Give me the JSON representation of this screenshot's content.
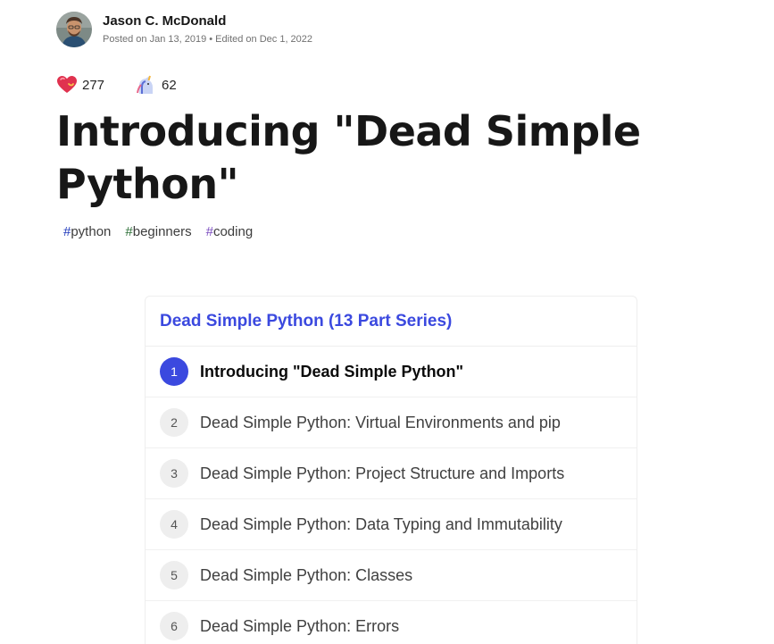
{
  "author": {
    "name": "Jason C. McDonald",
    "meta": "Posted on Jan 13, 2019 • Edited on Dec 1, 2022",
    "avatar_icon": "avatar-photo"
  },
  "reactions": [
    {
      "icon": "heart-icon",
      "count": "277"
    },
    {
      "icon": "unicorn-icon",
      "count": "62"
    }
  ],
  "article": {
    "title": "Introducing \"Dead Simple Python\""
  },
  "tags": [
    {
      "hash": "#",
      "name": "python"
    },
    {
      "hash": "#",
      "name": "beginners"
    },
    {
      "hash": "#",
      "name": "coding"
    }
  ],
  "series": {
    "title": "Dead Simple Python (13 Part Series)",
    "items": [
      {
        "number": "1",
        "label": "Introducing \"Dead Simple Python\"",
        "active": true
      },
      {
        "number": "2",
        "label": "Dead Simple Python: Virtual Environments and pip",
        "active": false
      },
      {
        "number": "3",
        "label": "Dead Simple Python: Project Structure and Imports",
        "active": false
      },
      {
        "number": "4",
        "label": "Dead Simple Python: Data Typing and Immutability",
        "active": false
      },
      {
        "number": "5",
        "label": "Dead Simple Python: Classes",
        "active": false
      },
      {
        "number": "6",
        "label": "Dead Simple Python: Errors",
        "active": false
      }
    ]
  },
  "colors": {
    "accent": "#3b49df",
    "text": "#171717",
    "muted": "#717171"
  }
}
